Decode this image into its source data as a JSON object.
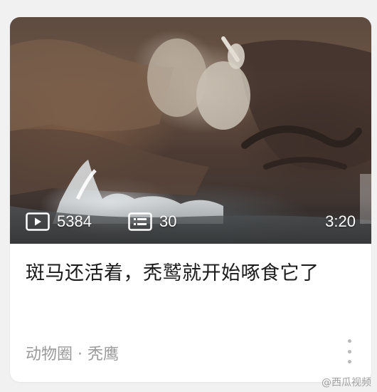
{
  "card": {
    "thumbnail": {
      "stats": {
        "views": "5384",
        "danmaku": "30"
      },
      "duration": "3:20",
      "icons": {
        "views": "play-icon",
        "danmaku": "danmaku-list-icon"
      }
    },
    "title": "斑马还活着，秃鹫就开始啄食它了",
    "meta": "动物圈 · 秃鹰",
    "more_icon": "more-vertical-icon"
  },
  "watermark": "@西瓜视频",
  "colors": {
    "page_background": "#f1f1f1",
    "card_background": "#ffffff",
    "title_text": "#1b1b1b",
    "meta_text": "#9a9a9a",
    "overlay_text": "#ffffff"
  }
}
